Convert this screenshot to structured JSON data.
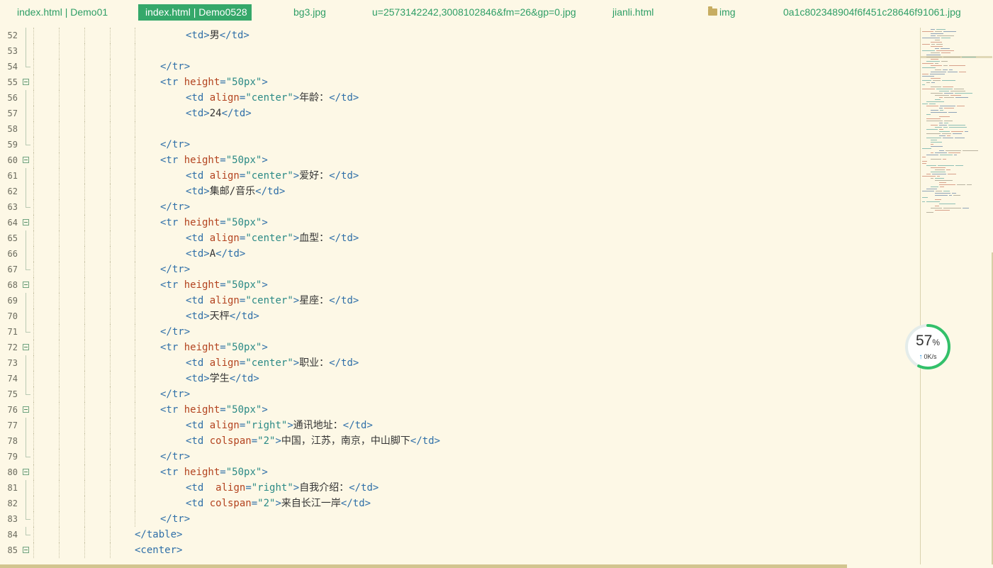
{
  "tabs": [
    {
      "label": "index.html | Demo01",
      "active": false
    },
    {
      "label": "index.html | Demo0528",
      "active": true
    },
    {
      "label": "bg3.jpg",
      "active": false
    },
    {
      "label": "u=2573142242,3008102846&fm=26&gp=0.jpg",
      "active": false
    },
    {
      "label": "jianli.html",
      "active": false
    },
    {
      "label": "img",
      "active": false,
      "icon": "folder-icon"
    },
    {
      "label": "0a1c802348904f6f451c28646f91061.jpg",
      "active": false
    }
  ],
  "code_lines": [
    {
      "num": "52",
      "fold": "bar",
      "tokens": [
        [
          "tag",
          "<td>"
        ],
        [
          "txt",
          "男"
        ],
        [
          "tag",
          "</td>"
        ]
      ]
    },
    {
      "num": "53",
      "fold": "bar",
      "tokens": []
    },
    {
      "num": "54",
      "fold": "end",
      "tokens": [
        [
          "tag",
          "</tr>"
        ]
      ]
    },
    {
      "num": "55",
      "fold": "open",
      "tokens": [
        [
          "tag",
          "<tr "
        ],
        [
          "attr",
          "height"
        ],
        [
          "tag",
          "="
        ],
        [
          "str",
          "\"50px\""
        ],
        [
          "tag",
          ">"
        ]
      ]
    },
    {
      "num": "56",
      "fold": "bar",
      "tokens": [
        [
          "tag",
          "<td "
        ],
        [
          "attr",
          "align"
        ],
        [
          "tag",
          "="
        ],
        [
          "str",
          "\"center\""
        ],
        [
          "tag",
          ">"
        ],
        [
          "txt",
          "年龄："
        ],
        [
          "tag",
          "</td>"
        ]
      ]
    },
    {
      "num": "57",
      "fold": "bar",
      "tokens": [
        [
          "tag",
          "<td>"
        ],
        [
          "txt",
          "24"
        ],
        [
          "tag",
          "</td>"
        ]
      ]
    },
    {
      "num": "58",
      "fold": "bar",
      "tokens": []
    },
    {
      "num": "59",
      "fold": "end",
      "tokens": [
        [
          "tag",
          "</tr>"
        ]
      ]
    },
    {
      "num": "60",
      "fold": "open",
      "tokens": [
        [
          "tag",
          "<tr "
        ],
        [
          "attr",
          "height"
        ],
        [
          "tag",
          "="
        ],
        [
          "str",
          "\"50px\""
        ],
        [
          "tag",
          ">"
        ]
      ]
    },
    {
      "num": "61",
      "fold": "bar",
      "tokens": [
        [
          "tag",
          "<td "
        ],
        [
          "attr",
          "align"
        ],
        [
          "tag",
          "="
        ],
        [
          "str",
          "\"center\""
        ],
        [
          "tag",
          ">"
        ],
        [
          "txt",
          "爱好："
        ],
        [
          "tag",
          "</td>"
        ]
      ]
    },
    {
      "num": "62",
      "fold": "bar",
      "tokens": [
        [
          "tag",
          "<td>"
        ],
        [
          "txt",
          "集邮/音乐"
        ],
        [
          "tag",
          "</td>"
        ]
      ]
    },
    {
      "num": "63",
      "fold": "end",
      "tokens": [
        [
          "tag",
          "</tr>"
        ]
      ]
    },
    {
      "num": "64",
      "fold": "open",
      "tokens": [
        [
          "tag",
          "<tr "
        ],
        [
          "attr",
          "height"
        ],
        [
          "tag",
          "="
        ],
        [
          "str",
          "\"50px\""
        ],
        [
          "tag",
          ">"
        ]
      ]
    },
    {
      "num": "65",
      "fold": "bar",
      "tokens": [
        [
          "tag",
          "<td "
        ],
        [
          "attr",
          "align"
        ],
        [
          "tag",
          "="
        ],
        [
          "str",
          "\"center\""
        ],
        [
          "tag",
          ">"
        ],
        [
          "txt",
          "血型："
        ],
        [
          "tag",
          "</td>"
        ]
      ]
    },
    {
      "num": "66",
      "fold": "bar",
      "tokens": [
        [
          "tag",
          "<td>"
        ],
        [
          "txt",
          "A"
        ],
        [
          "tag",
          "</td>"
        ]
      ]
    },
    {
      "num": "67",
      "fold": "end",
      "tokens": [
        [
          "tag",
          "</tr>"
        ]
      ]
    },
    {
      "num": "68",
      "fold": "open",
      "tokens": [
        [
          "tag",
          "<tr "
        ],
        [
          "attr",
          "height"
        ],
        [
          "tag",
          "="
        ],
        [
          "str",
          "\"50px\""
        ],
        [
          "tag",
          ">"
        ]
      ]
    },
    {
      "num": "69",
      "fold": "bar",
      "tokens": [
        [
          "tag",
          "<td "
        ],
        [
          "attr",
          "align"
        ],
        [
          "tag",
          "="
        ],
        [
          "str",
          "\"center\""
        ],
        [
          "tag",
          ">"
        ],
        [
          "txt",
          "星座："
        ],
        [
          "tag",
          "</td>"
        ]
      ]
    },
    {
      "num": "70",
      "fold": "bar",
      "tokens": [
        [
          "tag",
          "<td>"
        ],
        [
          "txt",
          "天枰"
        ],
        [
          "tag",
          "</td>"
        ]
      ]
    },
    {
      "num": "71",
      "fold": "end",
      "tokens": [
        [
          "tag",
          "</tr>"
        ]
      ]
    },
    {
      "num": "72",
      "fold": "open",
      "tokens": [
        [
          "tag",
          "<tr "
        ],
        [
          "attr",
          "height"
        ],
        [
          "tag",
          "="
        ],
        [
          "str",
          "\"50px\""
        ],
        [
          "tag",
          ">"
        ]
      ]
    },
    {
      "num": "73",
      "fold": "bar",
      "tokens": [
        [
          "tag",
          "<td "
        ],
        [
          "attr",
          "align"
        ],
        [
          "tag",
          "="
        ],
        [
          "str",
          "\"center\""
        ],
        [
          "tag",
          ">"
        ],
        [
          "txt",
          "职业："
        ],
        [
          "tag",
          "</td>"
        ]
      ]
    },
    {
      "num": "74",
      "fold": "bar",
      "tokens": [
        [
          "tag",
          "<td>"
        ],
        [
          "txt",
          "学生"
        ],
        [
          "tag",
          "</td>"
        ]
      ]
    },
    {
      "num": "75",
      "fold": "end",
      "tokens": [
        [
          "tag",
          "</tr>"
        ]
      ]
    },
    {
      "num": "76",
      "fold": "open",
      "tokens": [
        [
          "tag",
          "<tr "
        ],
        [
          "attr",
          "height"
        ],
        [
          "tag",
          "="
        ],
        [
          "str",
          "\"50px\""
        ],
        [
          "tag",
          ">"
        ]
      ]
    },
    {
      "num": "77",
      "fold": "bar",
      "tokens": [
        [
          "tag",
          "<td "
        ],
        [
          "attr",
          "align"
        ],
        [
          "tag",
          "="
        ],
        [
          "str",
          "\"right\""
        ],
        [
          "tag",
          ">"
        ],
        [
          "txt",
          "通讯地址："
        ],
        [
          "tag",
          "</td>"
        ]
      ]
    },
    {
      "num": "78",
      "fold": "bar",
      "tokens": [
        [
          "tag",
          "<td "
        ],
        [
          "attr",
          "colspan"
        ],
        [
          "tag",
          "="
        ],
        [
          "str",
          "\"2\""
        ],
        [
          "tag",
          ">"
        ],
        [
          "txt",
          "中国，江苏，南京，中山脚下"
        ],
        [
          "tag",
          "</td>"
        ]
      ]
    },
    {
      "num": "79",
      "fold": "end",
      "tokens": [
        [
          "tag",
          "</tr>"
        ]
      ]
    },
    {
      "num": "80",
      "fold": "open",
      "tokens": [
        [
          "tag",
          "<tr "
        ],
        [
          "attr",
          "height"
        ],
        [
          "tag",
          "="
        ],
        [
          "str",
          "\"50px\""
        ],
        [
          "tag",
          ">"
        ]
      ]
    },
    {
      "num": "81",
      "fold": "bar",
      "tokens": [
        [
          "tag",
          "<td  "
        ],
        [
          "attr",
          "align"
        ],
        [
          "tag",
          "="
        ],
        [
          "str",
          "\"right\""
        ],
        [
          "tag",
          ">"
        ],
        [
          "txt",
          "自我介绍："
        ],
        [
          "tag",
          "</td>"
        ]
      ]
    },
    {
      "num": "82",
      "fold": "bar",
      "tokens": [
        [
          "tag",
          "<td "
        ],
        [
          "attr",
          "colspan"
        ],
        [
          "tag",
          "="
        ],
        [
          "str",
          "\"2\""
        ],
        [
          "tag",
          ">"
        ],
        [
          "txt",
          "来自长江一岸"
        ],
        [
          "tag",
          "</td>"
        ]
      ]
    },
    {
      "num": "83",
      "fold": "end",
      "tokens": [
        [
          "tag",
          "</tr>"
        ]
      ]
    },
    {
      "num": "84",
      "fold": "end",
      "tokens": [
        [
          "tag",
          "</table>"
        ]
      ]
    },
    {
      "num": "85",
      "fold": "open",
      "tokens": [
        [
          "tag",
          "<center>"
        ]
      ]
    }
  ],
  "network_widget": {
    "percent": "57",
    "percent_sign": "%",
    "upload_arrow": "↑",
    "rate": "0K/s",
    "ring_color": "#33c06a",
    "usage_fraction": 0.57
  },
  "colors": {
    "background": "#fdf8e6",
    "tab_text": "#2e9e66",
    "tab_active_bg": "#35a86a",
    "tag": "#2f6fa8",
    "attribute": "#b3431f",
    "string": "#2b8a86"
  }
}
